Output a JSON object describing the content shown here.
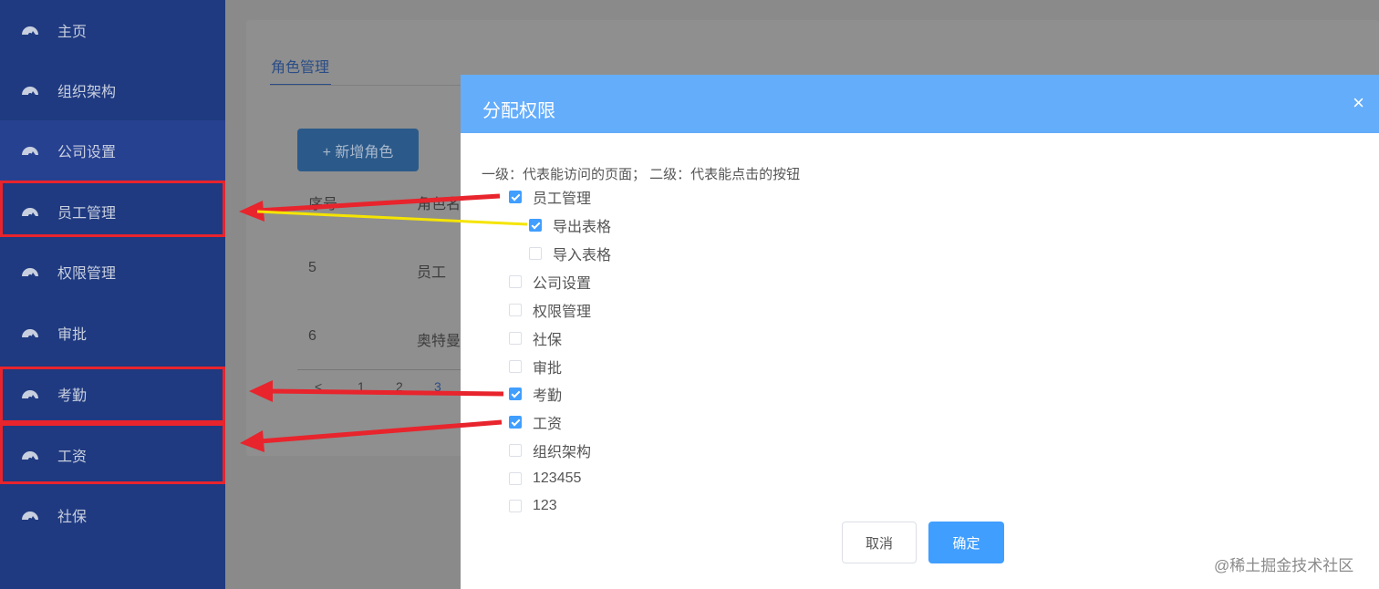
{
  "sidebar": {
    "items": [
      {
        "label": "主页",
        "icon": "dashboard-icon"
      },
      {
        "label": "组织架构",
        "icon": "dashboard-icon"
      },
      {
        "label": "公司设置",
        "icon": "dashboard-icon"
      },
      {
        "label": "员工管理",
        "icon": "dashboard-icon"
      },
      {
        "label": "权限管理",
        "icon": "dashboard-icon"
      },
      {
        "label": "审批",
        "icon": "dashboard-icon"
      },
      {
        "label": "考勤",
        "icon": "dashboard-icon"
      },
      {
        "label": "工资",
        "icon": "dashboard-icon"
      },
      {
        "label": "社保",
        "icon": "dashboard-icon"
      }
    ]
  },
  "main": {
    "tab_label": "角色管理",
    "add_button_label": "+ 新增角色",
    "table": {
      "headers": [
        "序号",
        "角色名"
      ],
      "rows": [
        [
          "5",
          "员工"
        ],
        [
          "6",
          "奥特曼"
        ]
      ]
    },
    "pagination": [
      "<",
      "1",
      "2",
      "3"
    ]
  },
  "dialog": {
    "title": "分配权限",
    "close_symbol": "×",
    "hint": "一级：代表能访问的页面； 二级：代表能点击的按钮",
    "tree": [
      {
        "label": "员工管理",
        "checked": true
      },
      {
        "label": "导出表格",
        "checked": true
      },
      {
        "label": "导入表格",
        "checked": false
      },
      {
        "label": "公司设置",
        "checked": false
      },
      {
        "label": "权限管理",
        "checked": false
      },
      {
        "label": "社保",
        "checked": false
      },
      {
        "label": "审批",
        "checked": false
      },
      {
        "label": "考勤",
        "checked": true
      },
      {
        "label": "工资",
        "checked": true
      },
      {
        "label": "组织架构",
        "checked": false
      },
      {
        "label": "123455",
        "checked": false
      },
      {
        "label": "123",
        "checked": false
      }
    ],
    "cancel_label": "取消",
    "confirm_label": "确定"
  },
  "watermark": "@稀土掘金技术社区",
  "colors": {
    "sidebar_bg": "#1f3a80",
    "dialog_header": "#64adfb",
    "primary": "#409eff",
    "highlight_red": "#e8242c",
    "arrow_yellow": "#f5e400"
  }
}
